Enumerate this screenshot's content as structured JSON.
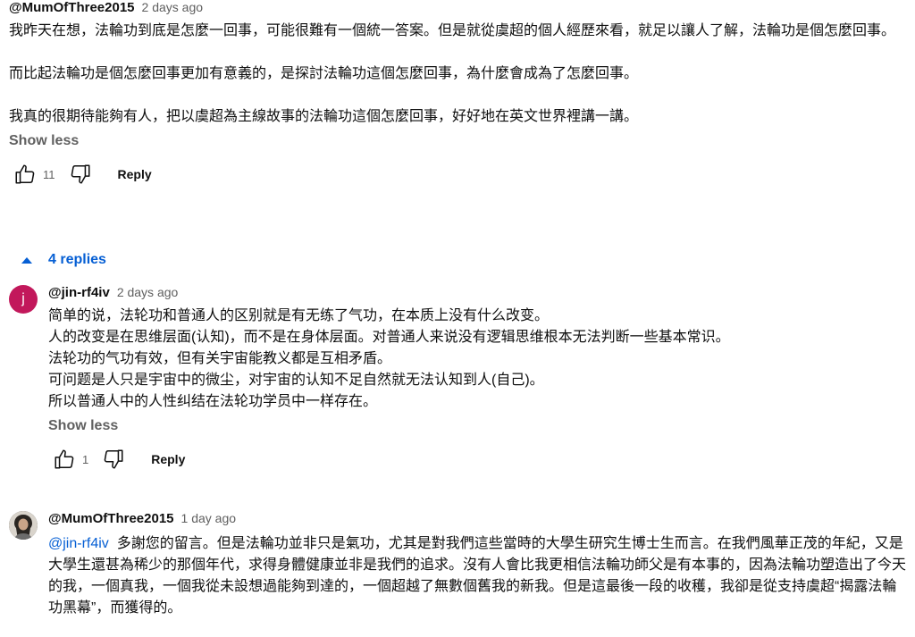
{
  "top_comment": {
    "author": "@MumOfThree2015",
    "time": "2 days ago",
    "text": "我昨天在想，法輪功到底是怎麼一回事，可能很難有一個統一答案。但是就從虞超的個人經歷來看，就足以讓人了解，法輪功是個怎麼回事。\n\n而比起法輪功是個怎麼回事更加有意義的，是探討法輪功這個怎麼回事，為什麼會成為了怎麼回事。\n\n我真的很期待能夠有人，把以虞超為主線故事的法輪功這個怎麼回事，好好地在英文世界裡講一講。",
    "show_less": "Show less",
    "like_count": "11",
    "reply_label": "Reply"
  },
  "replies_toggle": {
    "label": "4 replies"
  },
  "replies": [
    {
      "avatar_letter": "j",
      "author": "@jin-rf4iv",
      "time": "2 days ago",
      "text": "简单的说，法轮功和普通人的区别就是有无练了气功，在本质上没有什么改变。\n人的改变是在思维层面(认知)，而不是在身体层面。对普通人来说没有逻辑思维根本无法判断一些基本常识。\n法轮功的气功有效，但有关宇宙能教义都是互相矛盾。\n可问题是人只是宇宙中的微尘，对宇宙的认知不足自然就无法认知到人(自己)。\n所以普通人中的人性纠结在法轮功学员中一样存在。",
      "show_less": "Show less",
      "like_count": "1",
      "reply_label": "Reply"
    },
    {
      "author": "@MumOfThree2015",
      "time": "1 day ago",
      "mention": "@jin-rf4iv",
      "text": "多謝您的留言。但是法輪功並非只是氣功，尤其是對我們這些當時的大學生研究生博士生而言。在我們風華正茂的年紀，又是大學生還甚為稀少的那個年代，求得身體健康並非是我們的追求。沒有人會比我更相信法輪功師父是有本事的，因為法輪功塑造出了今天的我，一個真我，一個我從未設想過能夠到達的，一個超越了無數個舊我的新我。但是這最後一段的收穫，我卻是從支持虞超“揭露法輪功黑幕”，而獲得的。"
    }
  ],
  "icons": {
    "like": "thumbs-up-icon",
    "dislike": "thumbs-down-icon",
    "toggle": "caret-up-icon"
  },
  "colors": {
    "link": "#065fd4",
    "secondary_text": "#606060",
    "avatar_j": "#c2185b"
  }
}
